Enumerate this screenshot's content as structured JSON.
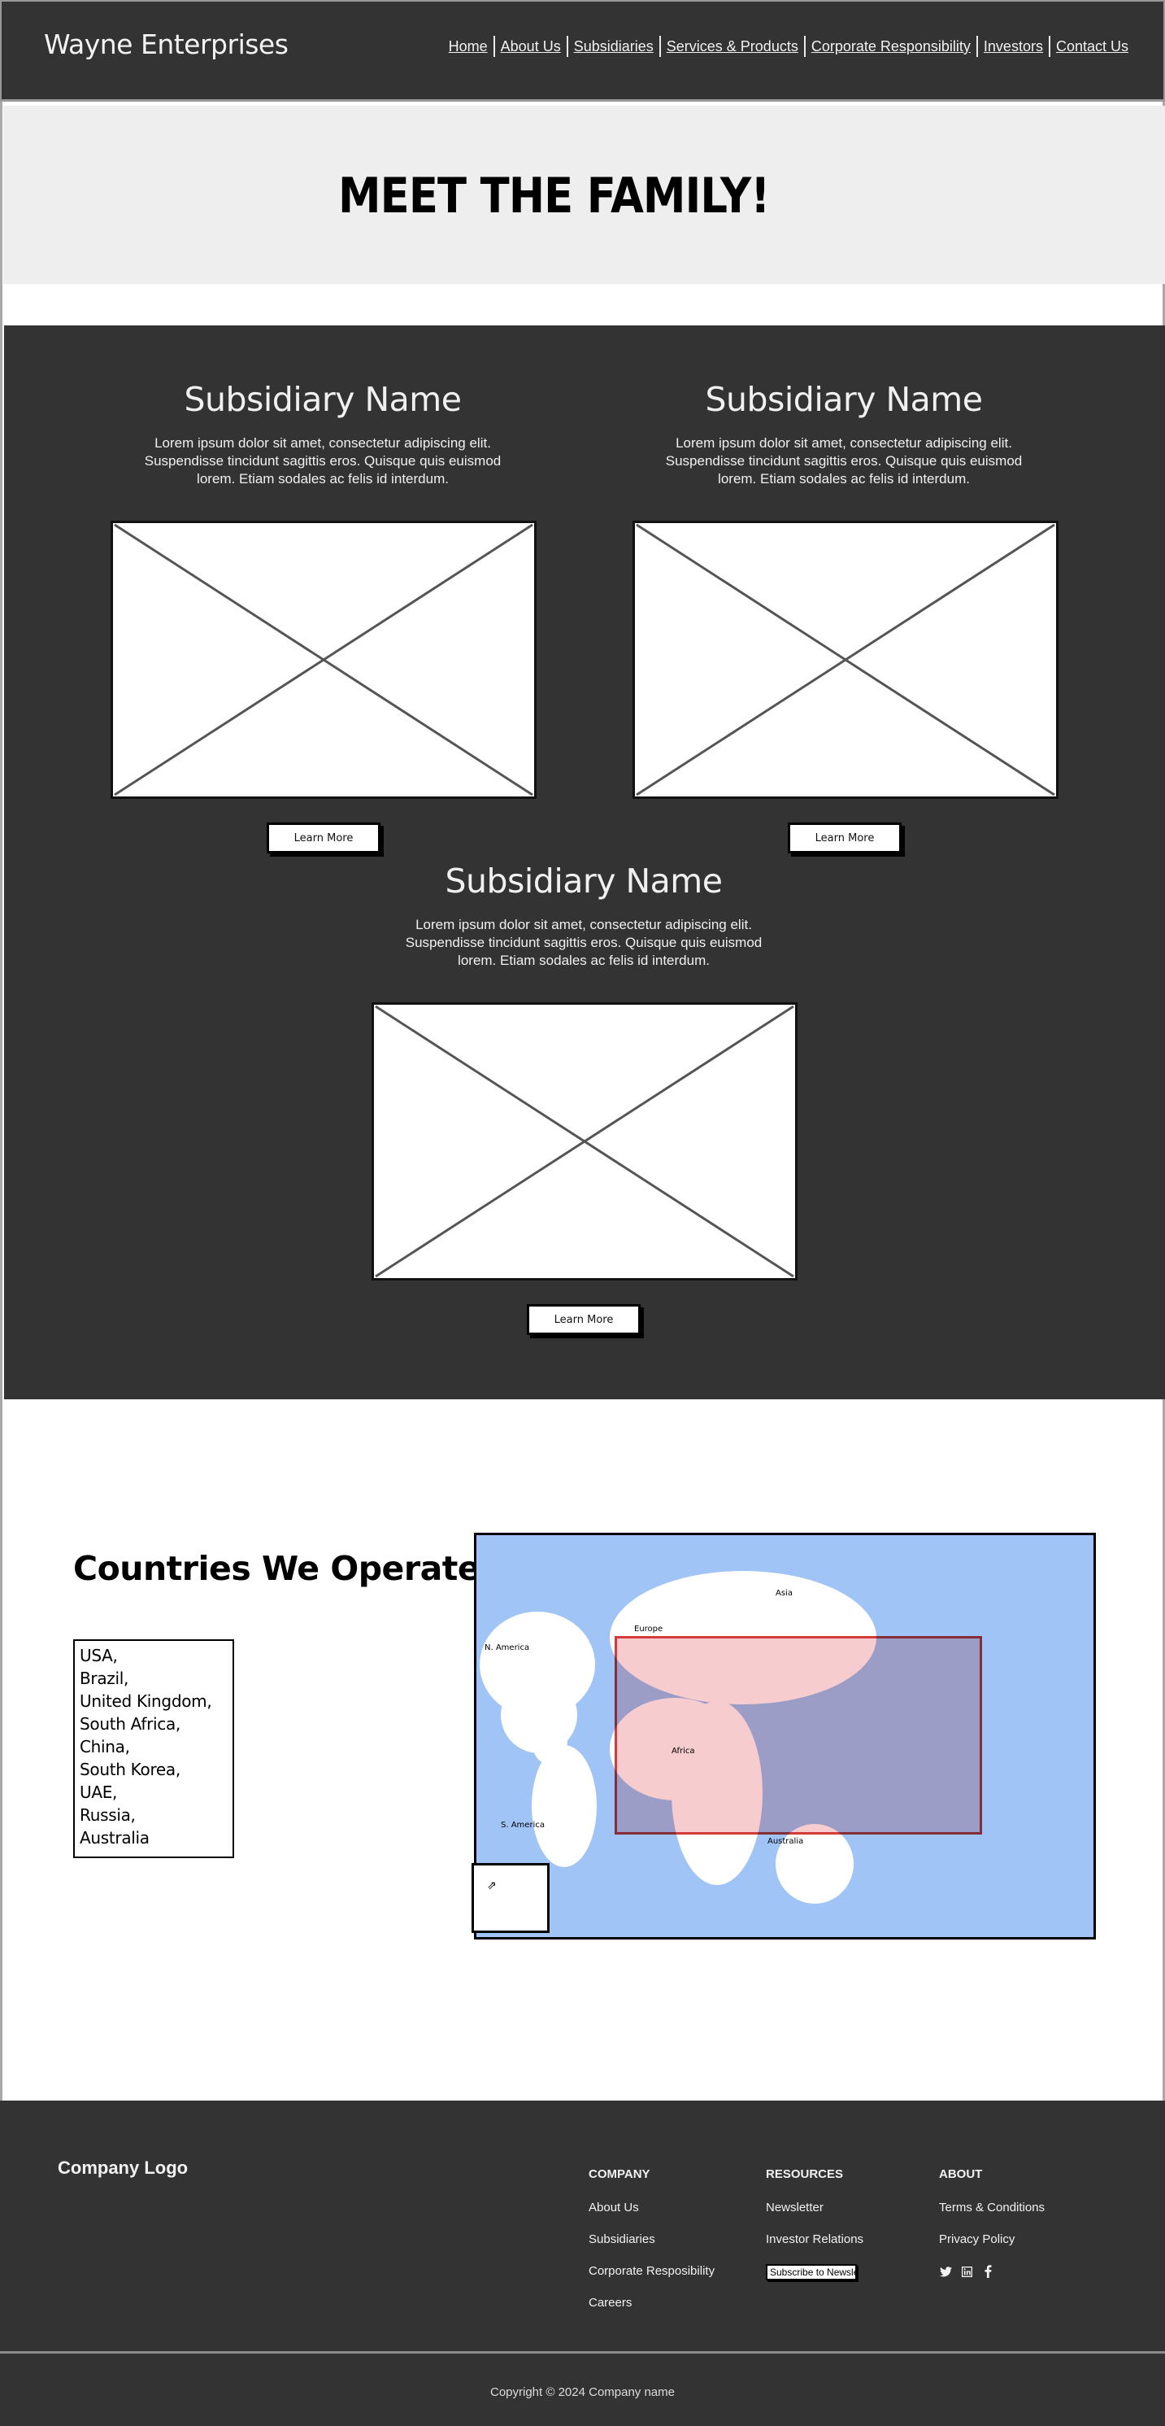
{
  "header": {
    "brand": "Wayne Enterprises",
    "nav": [
      "Home",
      "About Us",
      "Subsidiaries",
      "Services & Products",
      "Corporate Responsibility",
      "Investors",
      "Contact Us"
    ]
  },
  "hero": {
    "title": "MEET THE FAMILY!"
  },
  "subsidiaries": [
    {
      "name": "Subsidiary Name",
      "description": "Lorem ipsum dolor sit amet, consectetur adipiscing elit. Suspendisse tincidunt sagittis eros. Quisque quis euismod lorem. Etiam sodales ac felis id interdum.",
      "button": "Learn More",
      "image": "image-placeholder"
    },
    {
      "name": "Subsidiary Name",
      "description": "Lorem ipsum dolor sit amet, consectetur adipiscing elit. Suspendisse tincidunt sagittis eros. Quisque quis euismod lorem. Etiam sodales ac felis id interdum.",
      "button": "Learn More",
      "image": "image-placeholder"
    },
    {
      "name": "Subsidiary Name",
      "description": "Lorem ipsum dolor sit amet, consectetur adipiscing elit. Suspendisse tincidunt sagittis eros. Quisque quis euismod lorem. Etiam sodales ac felis id interdum.",
      "button": "Learn More",
      "image": "image-placeholder"
    }
  ],
  "countries": {
    "title": "Countries We Operate in",
    "list": [
      "USA,",
      "Brazil,",
      "United Kingdom,",
      "South Africa,",
      "China,",
      "South Korea,",
      "UAE,",
      "Russia,",
      "Australia"
    ]
  },
  "map": {
    "labels": {
      "north_america": "N. America",
      "south_america": "S. America",
      "europe": "Europe",
      "africa": "Africa",
      "asia": "Asia",
      "australia": "Australia"
    },
    "colors": {
      "ocean": "#a0c4f5",
      "land": "#ffffff",
      "highlight_border": "#d43c3c"
    },
    "inset_icon": "expand-icon"
  },
  "footer": {
    "logo": "Company Logo",
    "columns": [
      {
        "title": "COMPANY",
        "links": [
          "About Us",
          "Subsidiaries",
          "Corporate Resposibility",
          "Careers"
        ]
      },
      {
        "title": "RESOURCES",
        "links": [
          "Newsletter",
          "Investor Relations"
        ],
        "button": "Subscribe to Newsletter"
      },
      {
        "title": "ABOUT",
        "links": [
          "Terms & Conditions",
          "Privacy Policy"
        ],
        "socials": [
          "twitter-icon",
          "linkedin-icon",
          "facebook-icon"
        ]
      }
    ],
    "copyright": "Copyright © 2024 Company name"
  }
}
